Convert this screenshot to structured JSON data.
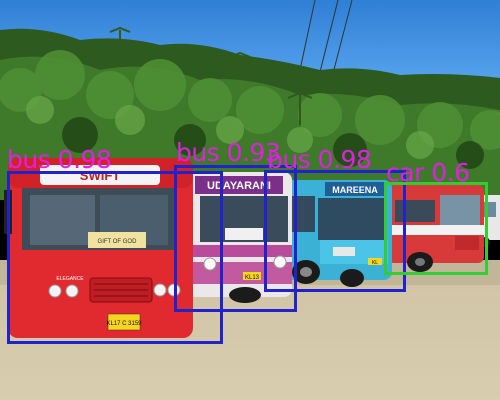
{
  "scene": {
    "description_icon": "photo-of-parked-buses",
    "bus_texts": {
      "bus1_destination": "SWIFT",
      "bus1_plate": "KL17 C 3159",
      "bus1_sign": "GIFT OF GOD",
      "bus1_brand": "ELEGANCE",
      "bus2_name": "UDAYARANI",
      "bus2_plate": "KL13",
      "bus3_name": "MAREENA",
      "bus3_plate": "KL"
    }
  },
  "detections": [
    {
      "label": "bus 0.98",
      "color": "#2222cc"
    },
    {
      "label": "bus 0.93",
      "color": "#2222cc"
    },
    {
      "label": "bus 0.98",
      "color": "#2222cc"
    },
    {
      "label": "car 0.6",
      "color": "#33cc33"
    }
  ],
  "label_color": "#e020e0"
}
